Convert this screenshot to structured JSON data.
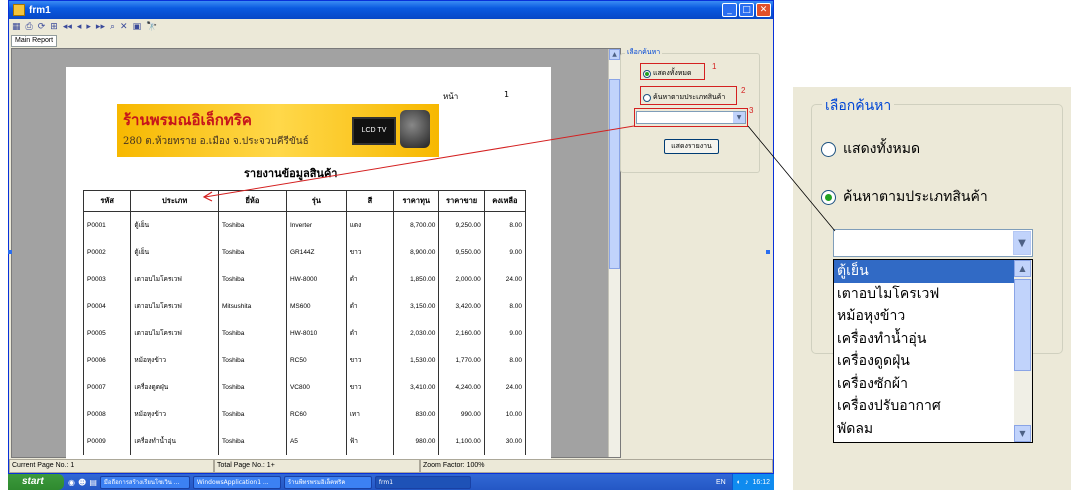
{
  "window": {
    "title": "frm1",
    "min": "_",
    "max": "□",
    "close": "✕"
  },
  "toolbar": {
    "items": [
      "▦",
      "⎙",
      "⟳",
      "⊞",
      "◂◂",
      "◂",
      "▸",
      "▸▸",
      "⌕",
      "✕",
      "▣",
      "🔭"
    ]
  },
  "report_tab": "Main Report",
  "report": {
    "page_label": "หน้า",
    "page_no": "1",
    "shop_name": "ร้านพรมณอิเล็กทริค",
    "shop_address": "280 ต.ห้วยทราย อ.เมือง จ.ประจวบคีรีขันธ์",
    "tv_label": "LCD TV",
    "title": "รายงานข้อมูลสินค้า",
    "columns": [
      "รหัส",
      "ประเภท",
      "ยี่ห้อ",
      "รุ่น",
      "สี",
      "ราคาทุน",
      "ราคาขาย",
      "คงเหลือ"
    ],
    "rows": [
      [
        "P0001",
        "ตู้เย็น",
        "Toshiba",
        "Inverter",
        "แดง",
        "8,700.00",
        "9,250.00",
        "8.00"
      ],
      [
        "P0002",
        "ตู้เย็น",
        "Toshiba",
        "GR144Z",
        "ขาว",
        "8,900.00",
        "9,550.00",
        "9.00"
      ],
      [
        "P0003",
        "เตาอบไมโครเวฟ",
        "Toshiba",
        "HW-8000",
        "ดำ",
        "1,850.00",
        "2,000.00",
        "24.00"
      ],
      [
        "P0004",
        "เตาอบไมโครเวฟ",
        "Mitsushita",
        "MS600",
        "ดำ",
        "3,150.00",
        "3,420.00",
        "8.00"
      ],
      [
        "P0005",
        "เตาอบไมโครเวฟ",
        "Toshiba",
        "HW-8010",
        "ดำ",
        "2,030.00",
        "2,160.00",
        "9.00"
      ],
      [
        "P0006",
        "หม้อหุงข้าว",
        "Toshiba",
        "RC50",
        "ขาว",
        "1,530.00",
        "1,770.00",
        "8.00"
      ],
      [
        "P0007",
        "เครื่องดูดฝุ่น",
        "Toshiba",
        "VC800",
        "ขาว",
        "3,410.00",
        "4,240.00",
        "24.00"
      ],
      [
        "P0008",
        "หม้อหุงข้าว",
        "Toshiba",
        "RC60",
        "เทา",
        "830.00",
        "990.00",
        "10.00"
      ],
      [
        "P0009",
        "เครื่องทำน้ำอุ่น",
        "Toshiba",
        "A5",
        "ฟ้า",
        "980.00",
        "1,100.00",
        "30.00"
      ]
    ]
  },
  "statusbar": {
    "current_page": "Current Page No.: 1",
    "total_page": "Total Page No.: 1+",
    "zoom": "Zoom Factor: 100%"
  },
  "search_panel": {
    "legend": "เลือกค้นหา",
    "radio_all": "แสดงทั้งหมด",
    "radio_type": "ค้นหาตามประเภทสินค้า",
    "show_button": "แสดงรายงาน",
    "callouts": [
      "1",
      "2",
      "3"
    ]
  },
  "zoom_panel": {
    "legend": "เลือกค้นหา",
    "radio_all": "แสดงทั้งหมด",
    "radio_type": "ค้นหาตามประเภทสินค้า",
    "dropdown_items": [
      "ตู้เย็น",
      "เตาอบไมโครเวฟ",
      "หม้อหุงข้าว",
      "เครื่องทำน้ำอุ่น",
      "เครื่องดูดฝุ่น",
      "เครื่องซักผ้า",
      "เครื่องปรับอากาศ",
      "พัดลม"
    ]
  },
  "taskbar": {
    "start": "start",
    "tasks": [
      "มือถือการสร้างเรียนโซเวิน ...",
      "WindowsApplication1 ...",
      "ร้านพีทรพรมอิเล็คทริค",
      "frm1"
    ],
    "lang": "EN",
    "clock": "16:12"
  },
  "colors": {
    "accent": "#0a5ae0",
    "callout": "#d42020",
    "selection": "#316ac5"
  }
}
